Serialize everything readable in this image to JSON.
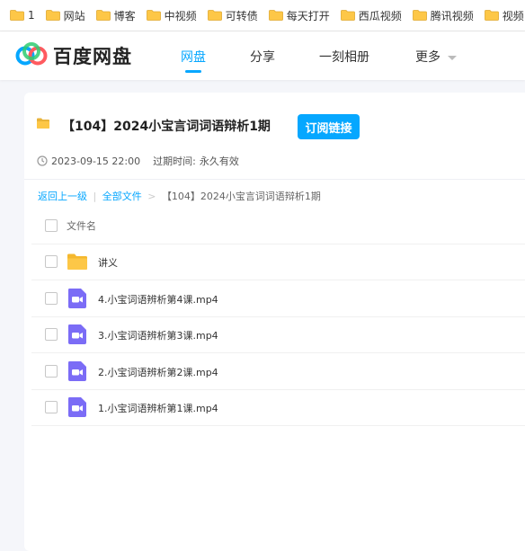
{
  "bookmarks": [
    "1",
    "网站",
    "博客",
    "中视频",
    "可转债",
    "每天打开",
    "西瓜视频",
    "腾讯视频",
    "视频"
  ],
  "header": {
    "logo_text": "百度网盘",
    "nav": [
      "网盘",
      "分享",
      "一刻相册",
      "更多"
    ],
    "active_nav": "网盘"
  },
  "share": {
    "title": "【104】2024小宝言词词语辩析1期",
    "subscribe_label": "订阅链接",
    "date": "2023-09-15 22:00",
    "expire_label": "过期时间:",
    "expire_value": "永久有效"
  },
  "breadcrumb": {
    "back": "返回上一级",
    "sep": "|",
    "all_files": "全部文件",
    "arrow": ">",
    "current": "【104】2024小宝言词词语辩析1期"
  },
  "table": {
    "column_header": "文件名",
    "rows": [
      {
        "name": "讲义",
        "type": "folder-icon"
      },
      {
        "name": "4.小宝词语辨析第4课.mp4",
        "type": "video-file-icon"
      },
      {
        "name": "3.小宝词语辨析第3课.mp4",
        "type": "video-file-icon"
      },
      {
        "name": "2.小宝词语辨析第2课.mp4",
        "type": "video-file-icon"
      },
      {
        "name": "1.小宝词语辨析第1课.mp4",
        "type": "video-file-icon"
      }
    ]
  },
  "colors": {
    "accent": "#06a7ff",
    "folder": "#fdc747",
    "video": "#7b6cf6"
  }
}
